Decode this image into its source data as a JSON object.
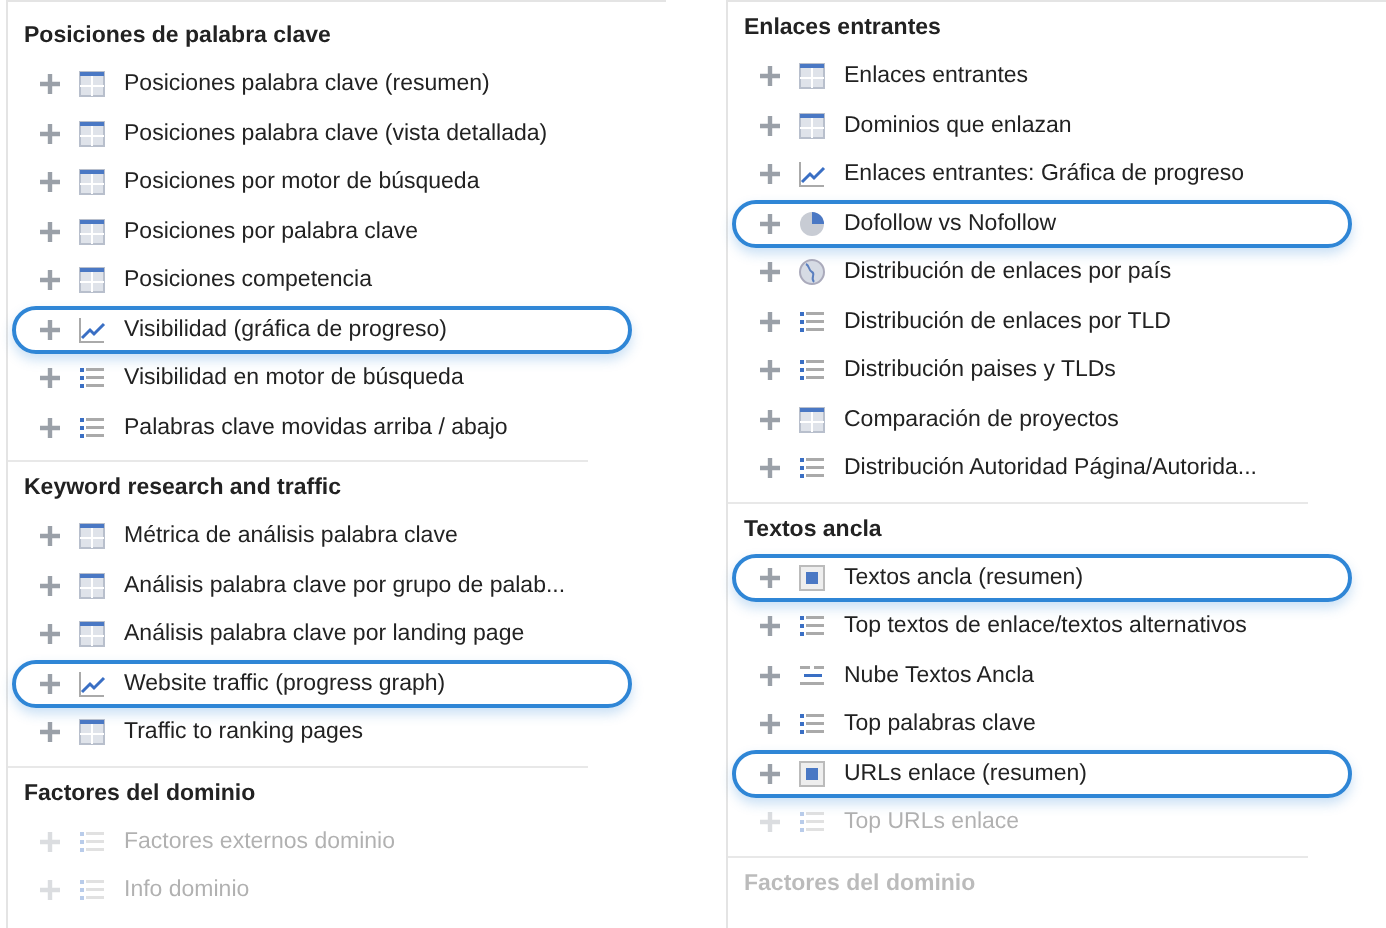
{
  "panels": [
    {
      "sections": [
        {
          "title": "Posiciones de palabra clave",
          "faded": false,
          "items": [
            {
              "label": "Posiciones palabra clave (resumen)",
              "kind": "table",
              "selected": false,
              "faded": false
            },
            {
              "label": "Posiciones palabra clave (vista detallada)",
              "kind": "table",
              "selected": false,
              "faded": false
            },
            {
              "label": "Posiciones por motor de búsqueda",
              "kind": "table",
              "selected": false,
              "faded": false
            },
            {
              "label": "Posiciones por palabra clave",
              "kind": "table",
              "selected": false,
              "faded": false
            },
            {
              "label": "Posiciones competencia",
              "kind": "table",
              "selected": false,
              "faded": false
            },
            {
              "label": "Visibilidad (gráfica de progreso)",
              "kind": "chart",
              "selected": true,
              "faded": false
            },
            {
              "label": "Visibilidad en motor de búsqueda",
              "kind": "list",
              "selected": false,
              "faded": false
            },
            {
              "label": "Palabras clave movidas arriba / abajo",
              "kind": "list",
              "selected": false,
              "faded": false
            }
          ]
        },
        {
          "title": "Keyword research and traffic",
          "faded": false,
          "items": [
            {
              "label": "Métrica de análisis palabra clave",
              "kind": "table",
              "selected": false,
              "faded": false
            },
            {
              "label": "Análisis palabra clave por grupo de palab...",
              "kind": "table",
              "selected": false,
              "faded": false
            },
            {
              "label": "Análisis palabra clave por landing page",
              "kind": "table",
              "selected": false,
              "faded": false
            },
            {
              "label": "Website traffic (progress graph)",
              "kind": "chart",
              "selected": true,
              "faded": false
            },
            {
              "label": "Traffic to ranking pages",
              "kind": "table",
              "selected": false,
              "faded": false
            }
          ]
        },
        {
          "title": "Factores del dominio",
          "faded": false,
          "items": [
            {
              "label": "Factores externos dominio",
              "kind": "list",
              "selected": false,
              "faded": true
            },
            {
              "label": "Info dominio",
              "kind": "list",
              "selected": false,
              "faded": true
            }
          ]
        }
      ]
    },
    {
      "sections": [
        {
          "title": "Enlaces entrantes",
          "faded": false,
          "items": [
            {
              "label": "Enlaces entrantes",
              "kind": "table",
              "selected": false,
              "faded": false
            },
            {
              "label": "Dominios que enlazan",
              "kind": "table",
              "selected": false,
              "faded": false
            },
            {
              "label": "Enlaces entrantes: Gráfica de progreso",
              "kind": "chart",
              "selected": false,
              "faded": false
            },
            {
              "label": "Dofollow vs Nofollow",
              "kind": "pie",
              "selected": true,
              "faded": false
            },
            {
              "label": "Distribución de enlaces por país",
              "kind": "globe",
              "selected": false,
              "faded": false
            },
            {
              "label": "Distribución de enlaces por TLD",
              "kind": "list",
              "selected": false,
              "faded": false
            },
            {
              "label": "Distribución paises y TLDs",
              "kind": "list",
              "selected": false,
              "faded": false
            },
            {
              "label": "Comparación de proyectos",
              "kind": "table",
              "selected": false,
              "faded": false
            },
            {
              "label": "Distribución Autoridad Página/Autorida...",
              "kind": "list",
              "selected": false,
              "faded": false
            }
          ]
        },
        {
          "title": "Textos ancla",
          "faded": false,
          "items": [
            {
              "label": "Textos ancla (resumen)",
              "kind": "summary",
              "selected": true,
              "faded": false
            },
            {
              "label": "Top textos de enlace/textos alternativos",
              "kind": "list",
              "selected": false,
              "faded": false
            },
            {
              "label": "Nube Textos Ancla",
              "kind": "cloud",
              "selected": false,
              "faded": false
            },
            {
              "label": "Top palabras clave",
              "kind": "list",
              "selected": false,
              "faded": false
            },
            {
              "label": "URLs enlace (resumen)",
              "kind": "summary",
              "selected": true,
              "faded": false
            },
            {
              "label": "Top URLs enlace",
              "kind": "list",
              "selected": false,
              "faded": true
            }
          ]
        },
        {
          "title": "Factores del dominio",
          "faded": true
        }
      ]
    }
  ]
}
